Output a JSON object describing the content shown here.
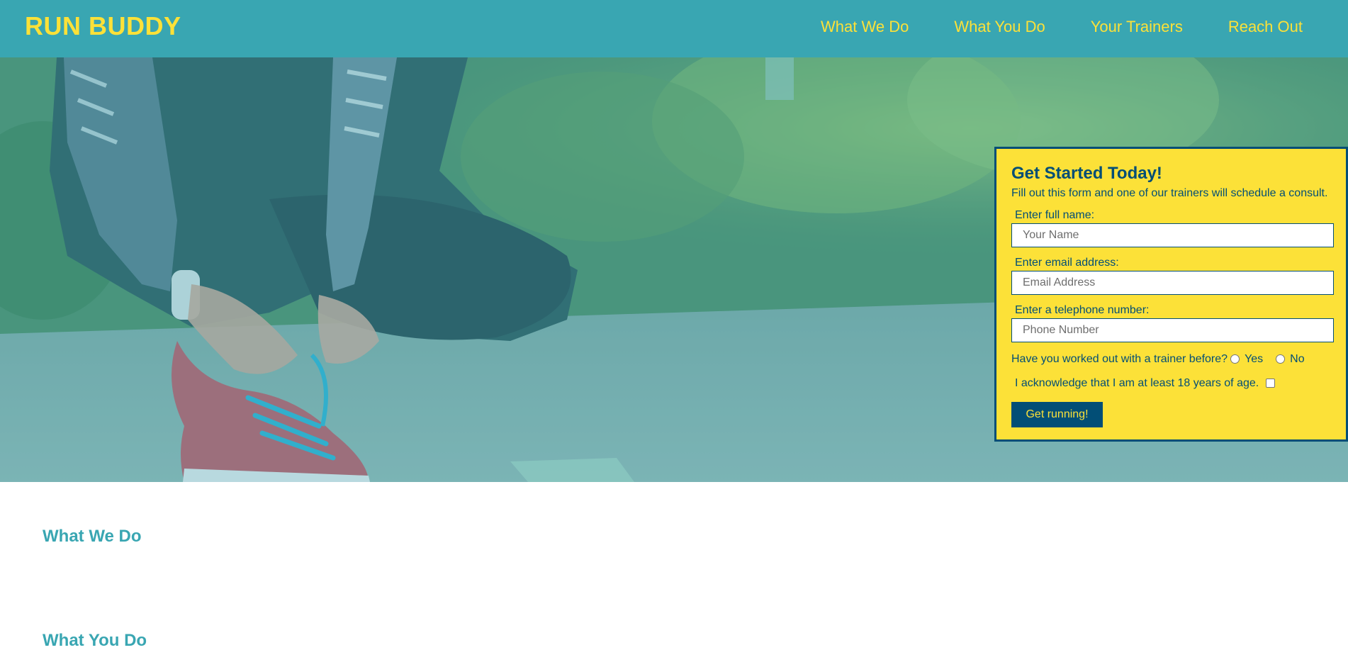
{
  "header": {
    "logo": "RUN BUDDY",
    "nav": [
      "What We Do",
      "What You Do",
      "Your Trainers",
      "Reach Out"
    ]
  },
  "form": {
    "title": "Get Started Today!",
    "subtitle": "Fill out this form and one of our trainers will schedule a consult.",
    "name_label": "Enter full name:",
    "name_placeholder": "Your Name",
    "email_label": "Enter email address:",
    "email_placeholder": "Email Address",
    "phone_label": "Enter a telephone number:",
    "phone_placeholder": "Phone Number",
    "trainer_question": "Have you worked out with a trainer before?",
    "yes_label": "Yes",
    "no_label": "No",
    "age_ack": "I acknowledge that I am at least 18 years of age.",
    "submit_label": "Get running!"
  },
  "sections": {
    "what_we_do": "What We Do",
    "what_you_do": "What You Do"
  },
  "colors": {
    "primary": "#39a6b2",
    "accent": "#fce138",
    "dark": "#024e76"
  }
}
